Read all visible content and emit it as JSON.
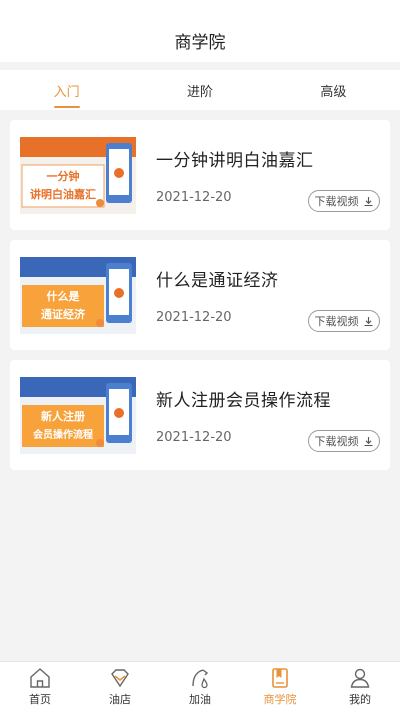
{
  "header": {
    "title": "商学院"
  },
  "tabs": [
    {
      "label": "入门",
      "active": true
    },
    {
      "label": "进阶",
      "active": false
    },
    {
      "label": "高级",
      "active": false
    }
  ],
  "courses": [
    {
      "title": "一分钟讲明白油嘉汇",
      "date": "2021-12-20",
      "download_label": "下载视频",
      "thumb_lines": [
        "一分钟",
        "讲明白油嘉汇"
      ],
      "thumb_bg": "#e8712a"
    },
    {
      "title": "什么是通证经济",
      "date": "2021-12-20",
      "download_label": "下载视频",
      "thumb_lines": [
        "什么是",
        "通证经济"
      ],
      "thumb_bg": "#3a67b8"
    },
    {
      "title": "新人注册会员操作流程",
      "date": "2021-12-20",
      "download_label": "下载视频",
      "thumb_lines": [
        "新人注册",
        "会员操作流程"
      ],
      "thumb_bg": "#3a67b8"
    }
  ],
  "tabbar": [
    {
      "label": "首页",
      "icon": "home-icon",
      "active": false
    },
    {
      "label": "油店",
      "icon": "diamond-icon",
      "active": false
    },
    {
      "label": "加油",
      "icon": "fuel-icon",
      "active": false
    },
    {
      "label": "商学院",
      "icon": "book-icon",
      "active": true
    },
    {
      "label": "我的",
      "icon": "user-icon",
      "active": false
    }
  ],
  "colors": {
    "accent": "#e8933a",
    "background": "#f3f3f3"
  }
}
